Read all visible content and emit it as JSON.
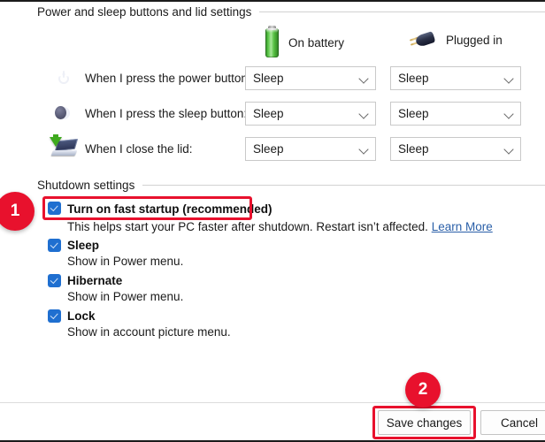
{
  "groups": {
    "power_lid": {
      "title": "Power and sleep buttons and lid settings"
    },
    "shutdown": {
      "title": "Shutdown settings"
    }
  },
  "columns": [
    {
      "label": "On battery",
      "icon": "battery-icon"
    },
    {
      "label": "Plugged in",
      "icon": "power-plug-icon"
    }
  ],
  "setting_rows": [
    {
      "icon": "power-button-icon",
      "label": "When I press the power button:",
      "on_battery": "Sleep",
      "plugged_in": "Sleep"
    },
    {
      "icon": "sleep-moon-icon",
      "label": "When I press the sleep button:",
      "on_battery": "Sleep",
      "plugged_in": "Sleep"
    },
    {
      "icon": "laptop-lid-icon",
      "label": "When I close the lid:",
      "on_battery": "Sleep",
      "plugged_in": "Sleep"
    }
  ],
  "shutdown_options": [
    {
      "label": "Turn on fast startup (recommended)",
      "checked": true,
      "description": "This helps start your PC faster after shutdown. Restart isn’t affected.",
      "link_text": "Learn More",
      "highlighted": true
    },
    {
      "label": "Sleep",
      "checked": true,
      "description": "Show in Power menu.",
      "link_text": "",
      "highlighted": false
    },
    {
      "label": "Hibernate",
      "checked": true,
      "description": "Show in Power menu.",
      "link_text": "",
      "highlighted": false
    },
    {
      "label": "Lock",
      "checked": true,
      "description": "Show in account picture menu.",
      "link_text": "",
      "highlighted": false
    }
  ],
  "footer": {
    "save_label": "Save changes",
    "cancel_label": "Cancel"
  },
  "annotations": {
    "badge_one": "1",
    "badge_two": "2",
    "highlight_color": "#e8112d"
  },
  "colors": {
    "checkbox_blue": "#1f6fd0",
    "link_blue": "#2a5fa8",
    "annotation_red": "#e8112d",
    "battery_green": "#55bf41"
  }
}
